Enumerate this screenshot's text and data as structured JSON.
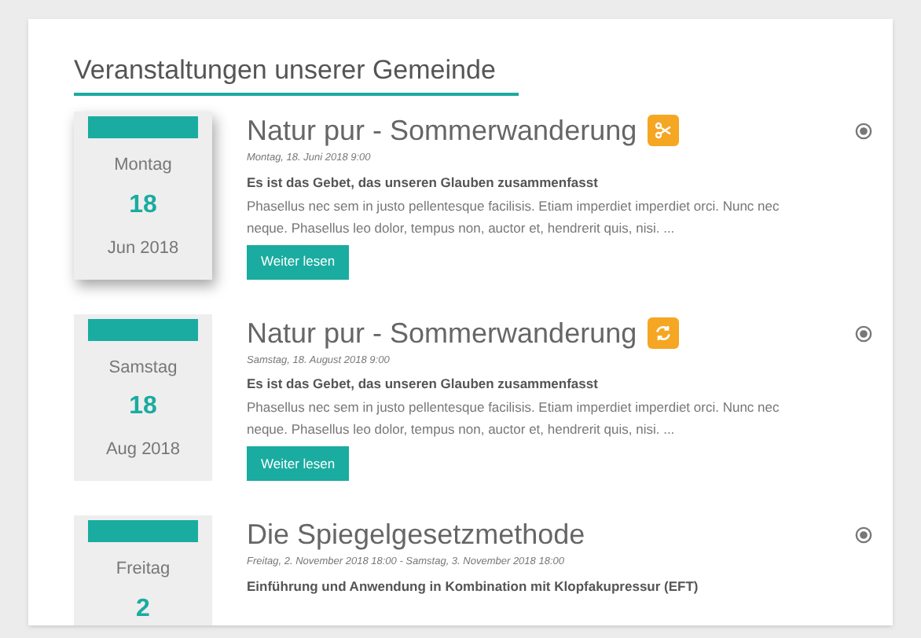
{
  "heading": "Veranstaltungen unserer Gemeinde",
  "events": [
    {
      "weekday": "Montag",
      "day": "18",
      "month_year": "Jun 2018",
      "raised": true,
      "title": "Natur pur - Sommerwanderung",
      "kind": "scissors",
      "when": "Montag, 18. Juni 2018 9:00",
      "subtitle": "Es ist das Gebet, das unseren Glauben zusammenfasst",
      "text": "Phasellus nec sem in justo pellentesque facilisis. Etiam imperdiet imperdiet orci. Nunc nec neque. Phasellus leo dolor, tempus non, auctor et, hendrerit quis, nisi. ...",
      "button": "Weiter lesen"
    },
    {
      "weekday": "Samstag",
      "day": "18",
      "month_year": "Aug 2018",
      "raised": false,
      "title": "Natur pur - Sommerwanderung",
      "kind": "refresh",
      "when": "Samstag, 18. August 2018 9:00",
      "subtitle": "Es ist das Gebet, das unseren Glauben zusammenfasst",
      "text": "Phasellus nec sem in justo pellentesque facilisis. Etiam imperdiet imperdiet orci. Nunc nec neque. Phasellus leo dolor, tempus non, auctor et, hendrerit quis, nisi. ...",
      "button": "Weiter lesen"
    },
    {
      "weekday": "Freitag",
      "day": "2",
      "raised": false,
      "title": "Die Spiegelgesetzmethode",
      "when": "Freitag, 2. November 2018 18:00 - Samstag, 3. November 2018 18:00",
      "subtitle": "Einführung und Anwendung in Kombination mit Klopfakupressur (EFT)"
    }
  ]
}
